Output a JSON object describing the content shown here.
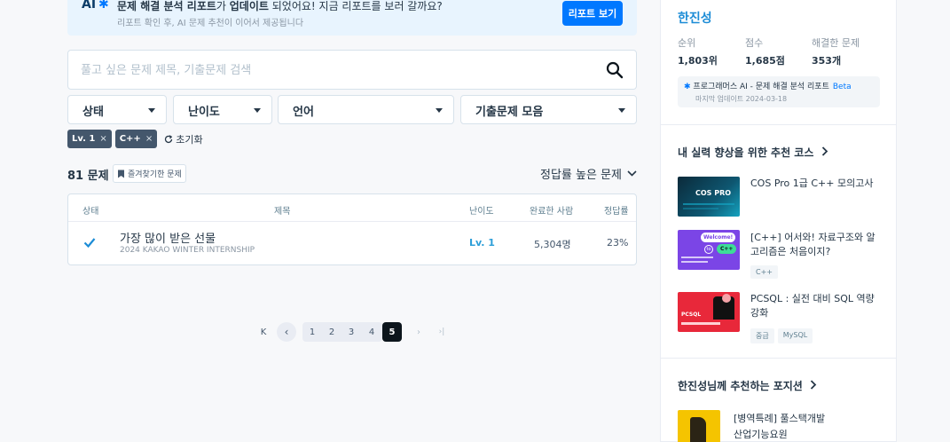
{
  "banner": {
    "ai_label": "AI",
    "title_bold_1": "문제 해결 분석 리포트",
    "title_mid": "가 ",
    "title_bold_2": "업데이트",
    "title_tail": " 되었어요! 지금 리포트를 보러 갈까요?",
    "subtitle": "리포트 확인 후, AI 문제 추천이 이어서 제공됩니다",
    "button_label": "리포트 보기"
  },
  "search": {
    "placeholder": "풀고 싶은 문제 제목, 기출문제 검색"
  },
  "filters": {
    "status": "상태",
    "difficulty": "난이도",
    "language": "언어",
    "collection": "기출문제 모음"
  },
  "chips": [
    {
      "label": "Lv. 1",
      "remove": "×"
    },
    {
      "label": "C++",
      "remove": "×"
    }
  ],
  "reset_label": "초기화",
  "list": {
    "count": "81 문제",
    "favorites_label": "즐겨찾기한 문제",
    "sort_label": "정답률 높은 문제",
    "headers": {
      "status": "상태",
      "title": "제목",
      "level": "난이도",
      "solved": "완료한 사람",
      "rate": "정답률"
    },
    "rows": [
      {
        "title": "가장 많이 받은 선물",
        "subtitle": "2024 KAKAO WINTER INTERNSHIP",
        "level": "Lv. 1",
        "solved": "5,304명",
        "rate": "23%"
      }
    ]
  },
  "pagination": {
    "first": "K",
    "prev": "‹",
    "pages": [
      "1",
      "2",
      "3",
      "4",
      "5"
    ],
    "current": "5",
    "next": "›",
    "last": "›|"
  },
  "profile": {
    "name": "한진성",
    "labels": {
      "rank": "순위",
      "score": "점수",
      "solved": "해결한 문제"
    },
    "values": {
      "rank": "1,803위",
      "score": "1,685점",
      "solved": "353개"
    },
    "report_title": "프로그래머스 AI - 문제 해결 분석 리포트",
    "report_badge": "Beta",
    "report_updated": "마지막 업데이트 2024-03-18"
  },
  "courses": {
    "heading": "내 실력 향상을 위한 추천 코스",
    "items": [
      {
        "title": "COS Pro 1급 C++ 모의고사",
        "tags": []
      },
      {
        "title": "[C++] 어서와! 자료구조와 알고리즘은 처음이지?",
        "tags": [
          "C++"
        ]
      },
      {
        "title": "PCSQL : 실전 대비 SQL 역량 강화",
        "tags": [
          "중급",
          "MySQL"
        ]
      }
    ],
    "thumb_texts": {
      "cos": "COS PRO",
      "welcome": "Welcome!",
      "to": "to",
      "cpp": "C++",
      "pcsql": "PCSQL"
    }
  },
  "positions": {
    "heading": "한진성님께 추천하는 포지션",
    "item_line1": "[병역특례] 풀스택개발",
    "item_line2": "산업기능요원"
  },
  "colors": {
    "accent": "#0078ff",
    "name_blue": "#1c8cd6",
    "level_blue": "#2c9ed8",
    "chip_bg": "#44576c",
    "active_page": "#0c151c"
  }
}
